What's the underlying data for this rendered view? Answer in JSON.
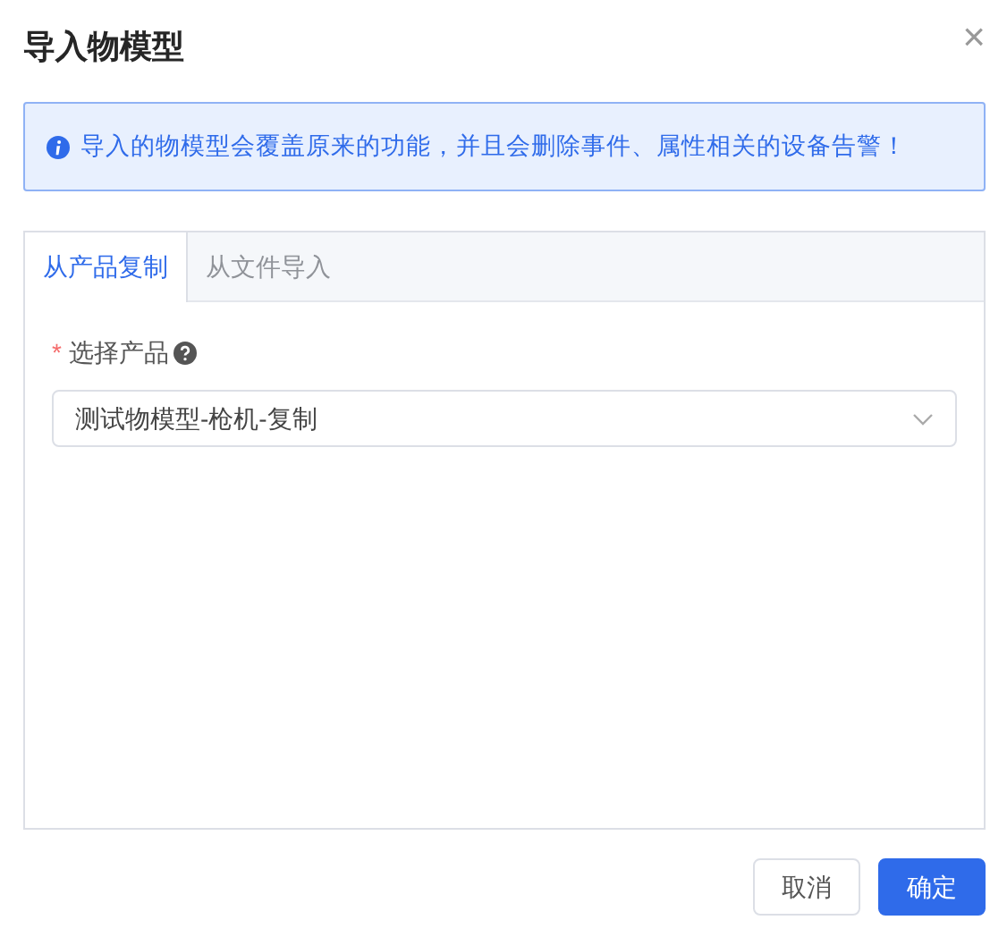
{
  "dialog": {
    "title": "导入物模型",
    "close": "×"
  },
  "alert": {
    "text": "导入的物模型会覆盖原来的功能，并且会删除事件、属性相关的设备告警！"
  },
  "tabs": [
    {
      "label": "从产品复制",
      "selected": true
    },
    {
      "label": "从文件导入",
      "selected": false
    }
  ],
  "form": {
    "required_mark": "*",
    "label": "选择产品",
    "select_value": "测试物模型-枪机-复制"
  },
  "buttons": [
    {
      "label": "取消",
      "kind": "secondary"
    },
    {
      "label": "确定",
      "kind": "primary"
    }
  ]
}
